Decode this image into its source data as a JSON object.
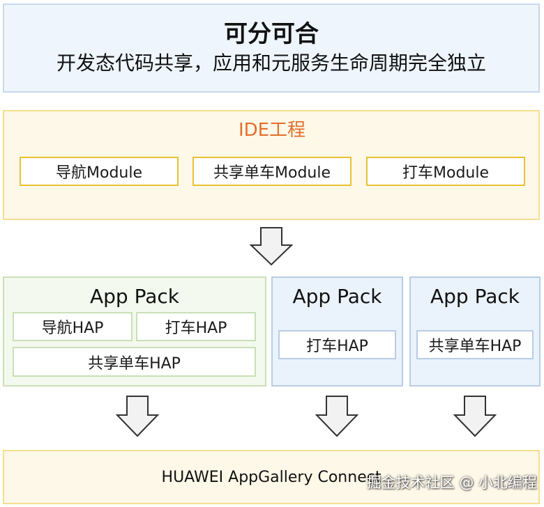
{
  "banner": {
    "title": "可分可合",
    "subtitle": "开发态代码共享，应用和元服务生命周期完全独立"
  },
  "ide": {
    "title": "IDE工程",
    "modules": [
      "导航Module",
      "共享单车Module",
      "打车Module"
    ]
  },
  "packs": [
    {
      "title": "App Pack",
      "haps": [
        "导航HAP",
        "打车HAP",
        "共享单车HAP"
      ]
    },
    {
      "title": "App Pack",
      "haps": [
        "打车HAP"
      ]
    },
    {
      "title": "App Pack",
      "haps": [
        "共享单车HAP"
      ]
    }
  ],
  "connect": {
    "label": "HUAWEI AppGallery Connect"
  },
  "watermark": "掘金技术社区 @ 小北编程",
  "colors": {
    "banner_bg": "#eef5fc",
    "ide_bg": "#fef8e8",
    "ide_title": "#e36e2c",
    "module_border": "#e6c235",
    "pack_green_bg": "#f3f9ee",
    "pack_blue_bg": "#eaf2fb"
  }
}
